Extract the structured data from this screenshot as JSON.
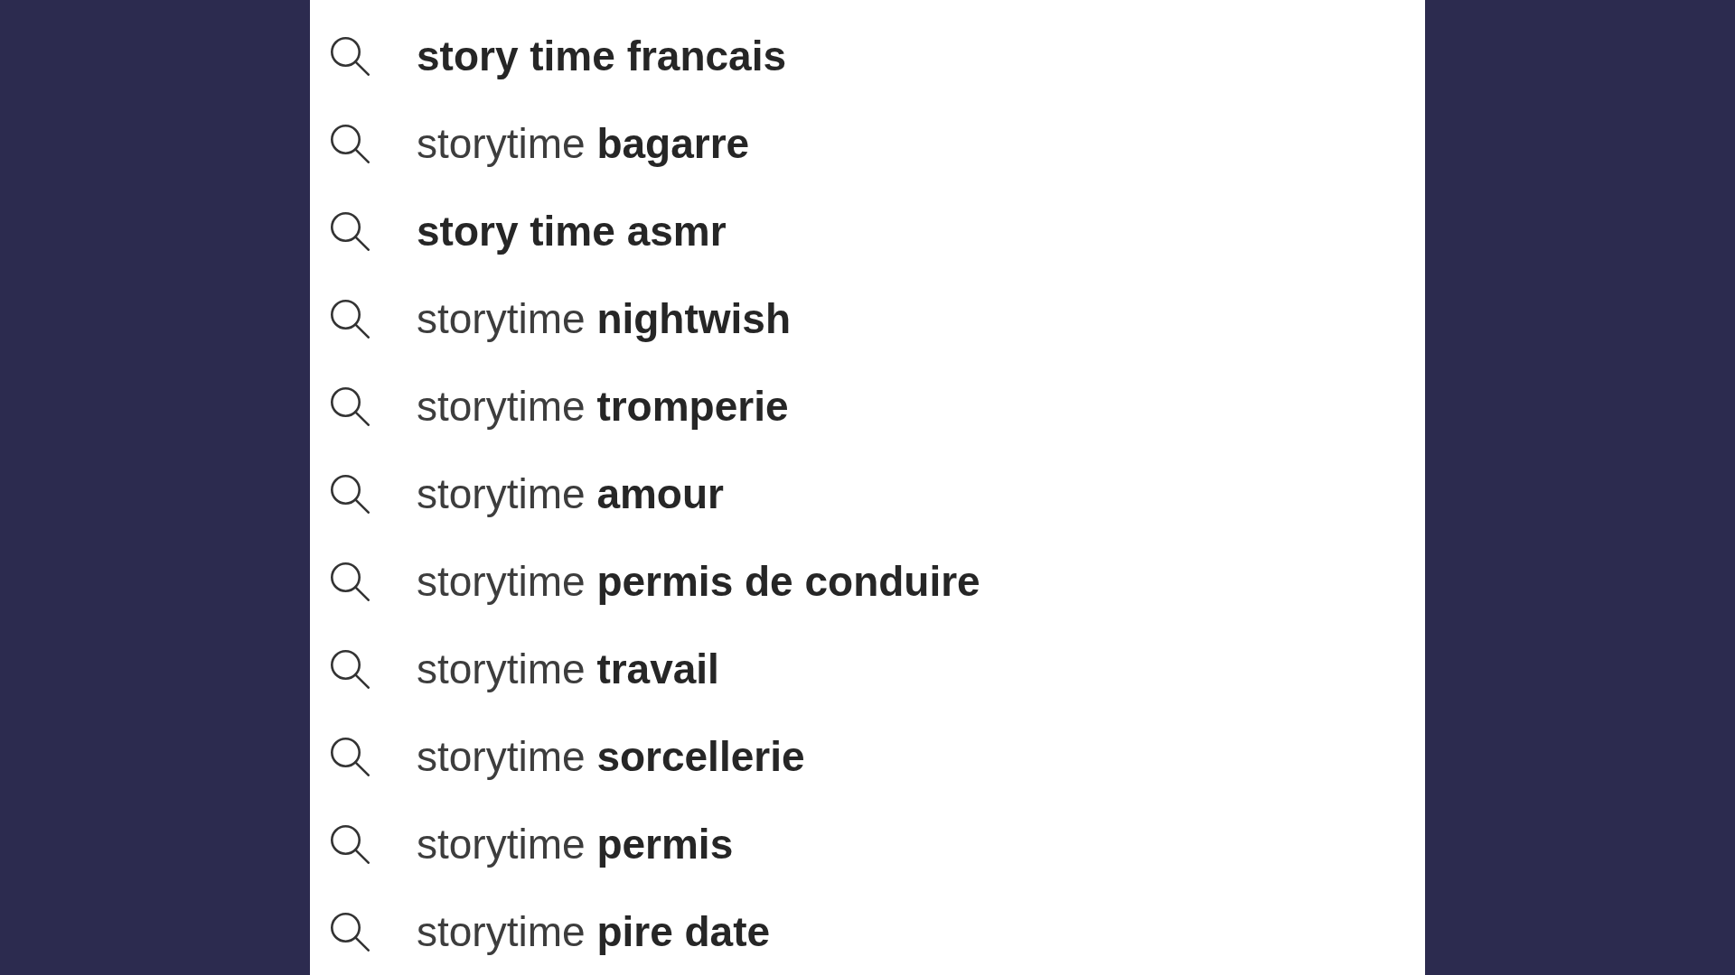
{
  "suggestions": [
    {
      "completion": "story time francais"
    },
    {
      "typed": "storytime",
      "completion": "bagarre"
    },
    {
      "completion": "story time asmr"
    },
    {
      "typed": "storytime",
      "completion": "nightwish"
    },
    {
      "typed": "storytime",
      "completion": "tromperie"
    },
    {
      "typed": "storytime",
      "completion": "amour"
    },
    {
      "typed": "storytime",
      "completion": "permis de conduire"
    },
    {
      "typed": "storytime",
      "completion": "travail"
    },
    {
      "typed": "storytime",
      "completion": "sorcellerie"
    },
    {
      "typed": "storytime",
      "completion": "permis"
    },
    {
      "typed": "storytime",
      "completion": "pire date"
    }
  ]
}
